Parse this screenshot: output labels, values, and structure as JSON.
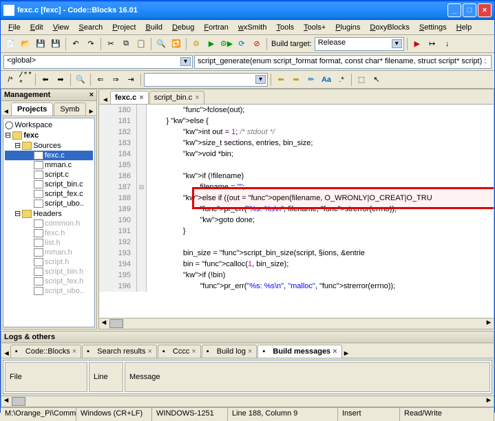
{
  "window": {
    "title": "fexc.c [fexc] - Code::Blocks 16.01"
  },
  "menu": [
    "File",
    "Edit",
    "View",
    "Search",
    "Project",
    "Build",
    "Debug",
    "Fortran",
    "wxSmith",
    "Tools",
    "Tools+",
    "Plugins",
    "DoxyBlocks",
    "Settings",
    "Help"
  ],
  "build_config": "Release",
  "scope_combo": "<global>",
  "func_desc": "script_generate(enum script_format format, const char* filename, struct script* script) :",
  "mgmt": {
    "title": "Management",
    "tabs": [
      "Projects",
      "Symb"
    ],
    "tree": {
      "root": "Workspace",
      "project": "fexc",
      "folders": [
        {
          "name": "Sources",
          "files": [
            "fexc.c",
            "mman.c",
            "script.c",
            "script_bin.c",
            "script_fex.c",
            "script_uboot.c"
          ],
          "selected": "fexc.c"
        },
        {
          "name": "Headers",
          "files": [
            "common.h",
            "fexc.h",
            "list.h",
            "mman.h",
            "script.h",
            "script_bin.h",
            "script_fex.h",
            "script_uboot.h"
          ],
          "dim": true
        }
      ]
    }
  },
  "editor": {
    "tabs": [
      {
        "name": "fexc.c",
        "active": true
      },
      {
        "name": "script_bin.c",
        "active": false
      }
    ],
    "startLine": 180,
    "highlightLine": 188,
    "lines": [
      "                fclose(out);",
      "        } else {",
      "                int out = 1; /* stdout */",
      "                size_t sections, entries, bin_size;",
      "                void *bin;",
      "",
      "                if (!filename)",
      "                        filename = \"<stdout>\";",
      "                else if ((out = open(filename, O_WRONLY|O_CREAT|O_TRU",
      "                        pr_err(\"%s: %s\\n\", filename, strerror(errno));",
      "                        goto done;",
      "                }",
      "",
      "                bin_size = script_bin_size(script, &sections, &entrie",
      "                bin = calloc(1, bin_size);",
      "                if (!bin)",
      "                        pr_err(\"%s: %s\\n\", \"malloc\", strerror(errno));"
    ]
  },
  "logs": {
    "title": "Logs & others",
    "tabs": [
      "Code::Blocks",
      "Search results",
      "Cccc",
      "Build log",
      "Build messages"
    ],
    "active": "Build messages",
    "columns": [
      "File",
      "Line",
      "Message"
    ]
  },
  "status": {
    "path": "M:\\Orange_Pi\\CommonT",
    "eol": "Windows (CR+LF)",
    "encoding": "WINDOWS-1251",
    "pos": "Line 188, Column 9",
    "mode": "Insert",
    "rw": "Read/Write"
  }
}
